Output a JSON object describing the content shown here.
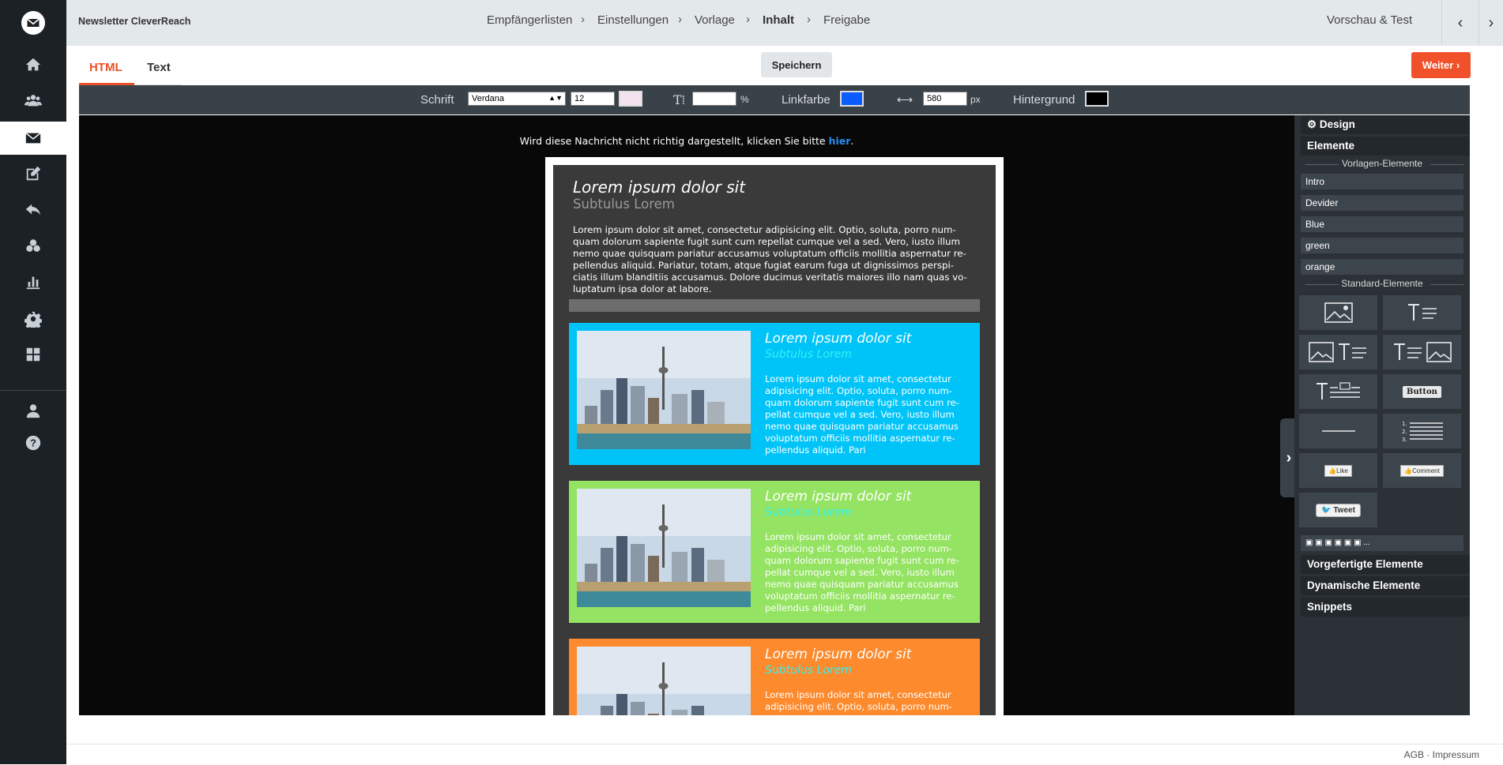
{
  "app": {
    "title": "Newsletter CleverReach"
  },
  "breadcrumb": [
    {
      "label": "Empfängerlisten"
    },
    {
      "label": "Einstellungen"
    },
    {
      "label": "Vorlage"
    },
    {
      "label": "Inhalt"
    },
    {
      "label": "Freigabe"
    }
  ],
  "header": {
    "preview_label": "Vorschau & Test",
    "prev_icon": "chevron-left-icon",
    "next_icon": "chevron-right-icon"
  },
  "tabs": [
    {
      "label": "HTML"
    },
    {
      "label": "Text"
    }
  ],
  "actions": {
    "save_label": "Speichern",
    "next_label": "Weiter ›"
  },
  "toolbar": {
    "font_label": "Schrift",
    "font_value": "Verdana",
    "font_size": "12",
    "line_height_unit": "%",
    "link_color_label": "Linkfarbe",
    "width_value": "580",
    "width_unit": "px",
    "background_label": "Hintergrund",
    "colors": {
      "text": "#f4e3ee",
      "link": "#0a5cff",
      "background": "#000000"
    }
  },
  "preview": {
    "notice_text": "Wird diese Nachricht nicht richtig dargestellt, klicken Sie bitte ",
    "notice_link": "hier",
    "notice_end": ".",
    "intro": {
      "title": "Lorem ipsum dolor sit",
      "subtitle": "Subtulus Lorem",
      "body": "Lorem ipsum dolor sit amet, consectetur adipisicing elit. Optio, soluta, porro num-quam dolorum sapiente fugit sunt cum repellat cumque vel a sed. Vero, iusto illum nemo quae quisquam pariatur accusamus voluptatum officiis mollitia aspernatur re-pellendus aliquid. Pariatur, totam, atque fugiat earum fuga ut dignissimos perspi-ciatis illum blanditiis accusamus. Dolore ducimus veritatis maiores illo nam quas vo-luptatum ipsa dolor at labore."
    },
    "blocks": [
      {
        "color": "#00c4f8",
        "subtitle_color": "#2ff3f5",
        "title": "Lorem ipsum dolor sit",
        "subtitle": "Subtulus Lorem",
        "body": "Lorem ipsum dolor sit amet, consectetur adipisicing elit. Optio, soluta, porro num-quam dolorum sapiente fugit sunt cum re-pellat cumque vel a sed. Vero, iusto illum nemo quae quisquam pariatur accusamus voluptatum officiis mollitia aspernatur re-pellendus aliquid. Pari"
      },
      {
        "color": "#94e362",
        "subtitle_color": "#2ff3f5",
        "title": "Lorem ipsum dolor sit",
        "subtitle": "Subtulus Lorem",
        "body": "Lorem ipsum dolor sit amet, consectetur adipisicing elit. Optio, soluta, porro num-quam dolorum sapiente fugit sunt cum re-pellat cumque vel a sed. Vero, iusto illum nemo quae quisquam pariatur accusamus voluptatum officiis mollitia aspernatur re-pellendus aliquid. Pari"
      },
      {
        "color": "#fd8a2c",
        "subtitle_color": "#2ff3f5",
        "title": "Lorem ipsum dolor sit",
        "subtitle": "Subtulus Lorem",
        "body": "Lorem ipsum dolor sit amet, consectetur adipisicing elit. Optio, soluta, porro num-"
      }
    ]
  },
  "panel": {
    "design_label": "Design",
    "elements_label": "Elemente",
    "template_section": "Vorlagen-Elemente",
    "template_items": [
      {
        "label": "Intro"
      },
      {
        "label": "Devider"
      },
      {
        "label": "Blue"
      },
      {
        "label": "green"
      },
      {
        "label": "orange"
      }
    ],
    "standard_section": "Standard-Elemente",
    "button_label": "Button",
    "like_label": "Like",
    "comment_label": "Comment",
    "tweet_label": "Tweet",
    "social_more": "...",
    "prefab_label": "Vorgefertigte Elemente",
    "dynamic_label": "Dynamische Elemente",
    "snippets_label": "Snippets"
  },
  "footer": {
    "text": "AGB · Impressum"
  }
}
